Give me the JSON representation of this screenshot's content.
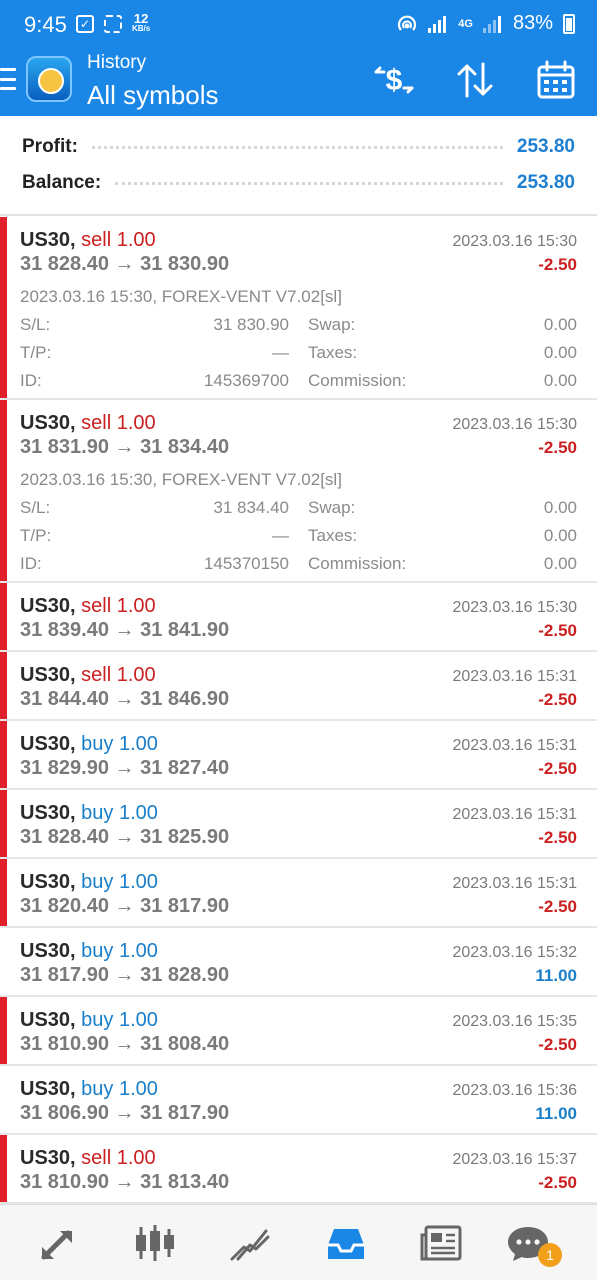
{
  "status_bar": {
    "time": "9:45",
    "net_speed_value": "12",
    "net_speed_unit": "KB/s",
    "network_label": "4G",
    "battery": "83%"
  },
  "toolbar": {
    "subtitle": "History",
    "title": "All symbols"
  },
  "summary": {
    "profit_label": "Profit:",
    "profit_value": "253.80",
    "balance_label": "Balance:",
    "balance_value": "253.80"
  },
  "labels": {
    "sl": "S/L:",
    "tp": "T/P:",
    "id": "ID:",
    "swap": "Swap:",
    "taxes": "Taxes:",
    "commission": "Commission:",
    "arrow": "→"
  },
  "deals": [
    {
      "symbol": "US30,",
      "direction": "sell 1.00",
      "dir_type": "sell",
      "open": "31 828.40",
      "close": "31 830.90",
      "time": "2023.03.16 15:30",
      "profit": "-2.50",
      "expanded": true,
      "comment": "2023.03.16 15:30, FOREX-VENT V7.02[sl]",
      "sl": "31 830.90",
      "tp": "—",
      "id": "145369700",
      "swap": "0.00",
      "taxes": "0.00",
      "commission": "0.00"
    },
    {
      "symbol": "US30,",
      "direction": "sell 1.00",
      "dir_type": "sell",
      "open": "31 831.90",
      "close": "31 834.40",
      "time": "2023.03.16 15:30",
      "profit": "-2.50",
      "expanded": true,
      "comment": "2023.03.16 15:30, FOREX-VENT V7.02[sl]",
      "sl": "31 834.40",
      "tp": "—",
      "id": "145370150",
      "swap": "0.00",
      "taxes": "0.00",
      "commission": "0.00"
    },
    {
      "symbol": "US30,",
      "direction": "sell 1.00",
      "dir_type": "sell",
      "open": "31 839.40",
      "close": "31 841.90",
      "time": "2023.03.16 15:30",
      "profit": "-2.50"
    },
    {
      "symbol": "US30,",
      "direction": "sell 1.00",
      "dir_type": "sell",
      "open": "31 844.40",
      "close": "31 846.90",
      "time": "2023.03.16 15:31",
      "profit": "-2.50"
    },
    {
      "symbol": "US30,",
      "direction": "buy 1.00",
      "dir_type": "buy",
      "open": "31 829.90",
      "close": "31 827.40",
      "time": "2023.03.16 15:31",
      "profit": "-2.50"
    },
    {
      "symbol": "US30,",
      "direction": "buy 1.00",
      "dir_type": "buy",
      "open": "31 828.40",
      "close": "31 825.90",
      "time": "2023.03.16 15:31",
      "profit": "-2.50"
    },
    {
      "symbol": "US30,",
      "direction": "buy 1.00",
      "dir_type": "buy",
      "open": "31 820.40",
      "close": "31 817.90",
      "time": "2023.03.16 15:31",
      "profit": "-2.50"
    },
    {
      "symbol": "US30,",
      "direction": "buy 1.00",
      "dir_type": "buy",
      "open": "31 817.90",
      "close": "31 828.90",
      "time": "2023.03.16 15:32",
      "profit": "11.00"
    },
    {
      "symbol": "US30,",
      "direction": "buy 1.00",
      "dir_type": "buy",
      "open": "31 810.90",
      "close": "31 808.40",
      "time": "2023.03.16 15:35",
      "profit": "-2.50"
    },
    {
      "symbol": "US30,",
      "direction": "buy 1.00",
      "dir_type": "buy",
      "open": "31 806.90",
      "close": "31 817.90",
      "time": "2023.03.16 15:36",
      "profit": "11.00"
    },
    {
      "symbol": "US30,",
      "direction": "sell 1.00",
      "dir_type": "sell",
      "open": "31 810.90",
      "close": "31 813.40",
      "time": "2023.03.16 15:37",
      "profit": "-2.50"
    }
  ],
  "bottom_nav": {
    "items": [
      "quotes-icon",
      "chart-icon",
      "trade-icon",
      "history-icon",
      "news-icon",
      "chat-icon"
    ],
    "chat_badge": "1"
  },
  "colors": {
    "accent": "#1a86e6",
    "loss": "#cc1f1f",
    "profit": "#1a7fc9"
  }
}
